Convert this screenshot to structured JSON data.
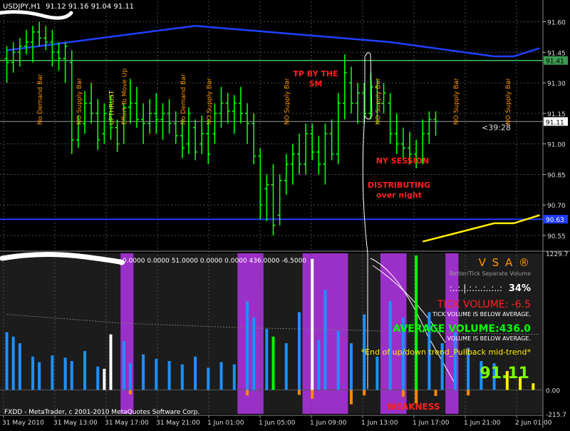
{
  "header": {
    "symbol_label": "USDJPY,H1",
    "ohlc_label": "91.12 91.16 91.04 91.11"
  },
  "price_panel": {
    "ylim": [
      90.48,
      91.7
    ],
    "tick_labels": [
      "91.60",
      "91.45",
      "91.30",
      "91.15",
      "91.00",
      "90.85",
      "90.70",
      "90.55"
    ],
    "tick_values": [
      91.6,
      91.45,
      91.3,
      91.15,
      91.0,
      90.85,
      90.7,
      90.55
    ],
    "current_price": "91.11",
    "green_level": "91.41",
    "blue_level": "90.63",
    "countdown": "<39:28",
    "bar_color": "#00ff00",
    "bars": [
      {
        "o": 91.42,
        "h": 91.48,
        "l": 91.3,
        "c": 91.4
      },
      {
        "o": 91.4,
        "h": 91.5,
        "l": 91.35,
        "c": 91.45
      },
      {
        "o": 91.45,
        "h": 91.52,
        "l": 91.38,
        "c": 91.48
      },
      {
        "o": 91.48,
        "h": 91.56,
        "l": 91.44,
        "c": 91.5
      },
      {
        "o": 91.5,
        "h": 91.58,
        "l": 91.4,
        "c": 91.55
      },
      {
        "o": 91.55,
        "h": 91.6,
        "l": 91.48,
        "c": 91.52
      },
      {
        "o": 91.52,
        "h": 91.58,
        "l": 91.46,
        "c": 91.5
      },
      {
        "o": 91.5,
        "h": 91.56,
        "l": 91.38,
        "c": 91.45
      },
      {
        "o": 91.45,
        "h": 91.5,
        "l": 91.36,
        "c": 91.42
      },
      {
        "o": 91.42,
        "h": 91.5,
        "l": 91.3,
        "c": 91.48
      },
      {
        "o": 91.4,
        "h": 91.46,
        "l": 90.95,
        "c": 91.02
      },
      {
        "o": 91.02,
        "h": 91.14,
        "l": 90.98,
        "c": 91.1
      },
      {
        "o": 91.1,
        "h": 91.26,
        "l": 91.05,
        "c": 91.2
      },
      {
        "o": 91.2,
        "h": 91.3,
        "l": 91.1,
        "c": 91.15
      },
      {
        "o": 91.15,
        "h": 91.22,
        "l": 90.97,
        "c": 91.02
      },
      {
        "o": 91.05,
        "h": 91.2,
        "l": 91.0,
        "c": 91.15
      },
      {
        "o": 91.12,
        "h": 91.24,
        "l": 91.02,
        "c": 91.08
      },
      {
        "o": 91.08,
        "h": 91.12,
        "l": 90.96,
        "c": 91.0
      },
      {
        "o": 91.1,
        "h": 91.2,
        "l": 91.0,
        "c": 91.18
      },
      {
        "o": 91.18,
        "h": 91.32,
        "l": 91.1,
        "c": 91.2
      },
      {
        "o": 91.2,
        "h": 91.28,
        "l": 91.08,
        "c": 91.12
      },
      {
        "o": 91.12,
        "h": 91.2,
        "l": 91.0,
        "c": 91.1
      },
      {
        "o": 91.1,
        "h": 91.22,
        "l": 91.05,
        "c": 91.15
      },
      {
        "o": 91.15,
        "h": 91.25,
        "l": 91.05,
        "c": 91.12
      },
      {
        "o": 91.12,
        "h": 91.2,
        "l": 91.02,
        "c": 91.15
      },
      {
        "o": 91.15,
        "h": 91.22,
        "l": 91.05,
        "c": 91.1
      },
      {
        "o": 91.1,
        "h": 91.16,
        "l": 91.0,
        "c": 91.04
      },
      {
        "o": 91.04,
        "h": 91.12,
        "l": 90.93,
        "c": 90.98
      },
      {
        "o": 91.0,
        "h": 91.18,
        "l": 90.95,
        "c": 91.15
      },
      {
        "o": 91.08,
        "h": 91.12,
        "l": 90.92,
        "c": 90.96
      },
      {
        "o": 91.0,
        "h": 91.14,
        "l": 90.95,
        "c": 91.05
      },
      {
        "o": 91.05,
        "h": 91.12,
        "l": 90.9,
        "c": 90.95
      },
      {
        "o": 91.05,
        "h": 91.2,
        "l": 91.0,
        "c": 91.15
      },
      {
        "o": 91.15,
        "h": 91.28,
        "l": 91.08,
        "c": 91.2
      },
      {
        "o": 91.2,
        "h": 91.25,
        "l": 91.1,
        "c": 91.16
      },
      {
        "o": 91.16,
        "h": 91.24,
        "l": 91.05,
        "c": 91.2
      },
      {
        "o": 91.2,
        "h": 91.28,
        "l": 91.1,
        "c": 91.15
      },
      {
        "o": 91.15,
        "h": 91.2,
        "l": 91.0,
        "c": 91.1
      },
      {
        "o": 91.1,
        "h": 91.15,
        "l": 90.9,
        "c": 90.94
      },
      {
        "o": 90.94,
        "h": 90.98,
        "l": 90.63,
        "c": 90.7
      },
      {
        "o": 90.78,
        "h": 90.85,
        "l": 90.62,
        "c": 90.8
      },
      {
        "o": 90.8,
        "h": 90.9,
        "l": 90.55,
        "c": 90.6
      },
      {
        "o": 90.65,
        "h": 90.85,
        "l": 90.6,
        "c": 90.82
      },
      {
        "o": 90.82,
        "h": 90.95,
        "l": 90.75,
        "c": 90.9
      },
      {
        "o": 90.9,
        "h": 91.0,
        "l": 90.8,
        "c": 90.95
      },
      {
        "o": 90.95,
        "h": 91.05,
        "l": 90.85,
        "c": 90.9
      },
      {
        "o": 90.9,
        "h": 91.1,
        "l": 90.85,
        "c": 91.05
      },
      {
        "o": 91.05,
        "h": 91.1,
        "l": 90.92,
        "c": 90.96
      },
      {
        "o": 90.96,
        "h": 91.04,
        "l": 90.85,
        "c": 90.9
      },
      {
        "o": 90.9,
        "h": 91.1,
        "l": 90.8,
        "c": 91.05
      },
      {
        "o": 91.05,
        "h": 91.12,
        "l": 90.92,
        "c": 90.95
      },
      {
        "o": 90.95,
        "h": 91.25,
        "l": 90.9,
        "c": 91.2
      },
      {
        "o": 91.2,
        "h": 91.44,
        "l": 91.12,
        "c": 91.35
      },
      {
        "o": 91.3,
        "h": 91.38,
        "l": 91.15,
        "c": 91.2
      },
      {
        "o": 91.2,
        "h": 91.3,
        "l": 91.1,
        "c": 91.25
      },
      {
        "o": 91.25,
        "h": 91.3,
        "l": 91.1,
        "c": 91.15
      },
      {
        "o": 91.15,
        "h": 91.35,
        "l": 91.12,
        "c": 91.28
      },
      {
        "o": 91.28,
        "h": 91.32,
        "l": 91.1,
        "c": 91.2
      },
      {
        "o": 91.2,
        "h": 91.3,
        "l": 91.15,
        "c": 91.25
      },
      {
        "o": 91.2,
        "h": 91.25,
        "l": 91.0,
        "c": 91.05
      },
      {
        "o": 91.05,
        "h": 91.15,
        "l": 90.95,
        "c": 91.0
      },
      {
        "o": 91.0,
        "h": 91.08,
        "l": 90.93,
        "c": 90.98
      },
      {
        "o": 90.98,
        "h": 91.06,
        "l": 90.9,
        "c": 90.95
      },
      {
        "o": 90.95,
        "h": 91.02,
        "l": 90.88,
        "c": 90.92
      },
      {
        "o": 90.92,
        "h": 91.12,
        "l": 90.9,
        "c": 91.05
      },
      {
        "o": 91.05,
        "h": 91.16,
        "l": 91.0,
        "c": 91.12
      },
      {
        "o": 91.12,
        "h": 91.16,
        "l": 91.04,
        "c": 91.11
      }
    ],
    "blue_trend": [
      [
        0,
        91.46
      ],
      [
        29,
        91.58
      ],
      [
        59,
        91.5
      ],
      [
        75,
        91.43
      ],
      [
        78,
        91.43
      ],
      [
        82,
        91.47
      ]
    ],
    "yellow_trend": [
      [
        64,
        90.52
      ],
      [
        75,
        90.61
      ],
      [
        78,
        90.61
      ],
      [
        82,
        90.65
      ]
    ],
    "vertical_labels": [
      {
        "bar": 5,
        "text": "No Demand Bar",
        "color": "#ff9900"
      },
      {
        "bar": 11,
        "text": "NO Supply Bar",
        "color": "#ff9900"
      },
      {
        "bar": 16,
        "text": "UPTHRUST",
        "color": "#ffee00"
      },
      {
        "bar": 18,
        "text": "Effort To Move Up",
        "color": "#ff9900"
      },
      {
        "bar": 27,
        "text": "No Demand Bar",
        "color": "#ff9900"
      },
      {
        "bar": 31,
        "text": "NO Supply Bar",
        "color": "#ff9900"
      },
      {
        "bar": 43,
        "text": "NO Supply Bar",
        "color": "#ff9900"
      },
      {
        "bar": 57,
        "text": "NO Supply Bar",
        "color": "#ff9900"
      },
      {
        "bar": 69,
        "text": "NO Supply Bar",
        "color": "#ff9900"
      },
      {
        "bar": 77,
        "text": "NO Supply Bar",
        "color": "#ff9900"
      }
    ],
    "annotations": [
      {
        "line1": "TP BY THE",
        "line2": "SM",
        "color": "#ff2020"
      },
      {
        "line1": "NY SESSION",
        "line2": "",
        "color": "#ff2020"
      },
      {
        "line1": "DISTRIBUTING",
        "line2": "over night",
        "color": "#ff2020"
      }
    ]
  },
  "volume_panel": {
    "header_values": "0.0000 0.0000 51.0000 0.0000 0.0000 436.0000 -6.5000",
    "ylim": [
      -215.7,
      1229.7
    ],
    "tick_labels": [
      "1229.7",
      "0.00",
      "-215.7"
    ],
    "tick_values": [
      1229.7,
      0.0,
      -215.7
    ],
    "purple_zones": [
      [
        18,
        19
      ],
      [
        36,
        39
      ],
      [
        46,
        52
      ],
      [
        58,
        61
      ],
      [
        68,
        69
      ]
    ],
    "bars": [
      {
        "v": 520,
        "c": "#1e90ff"
      },
      {
        "v": 480,
        "c": "#1e90ff"
      },
      {
        "v": 420,
        "c": "#1e90ff"
      },
      {
        "v": 0,
        "c": "#1e90ff"
      },
      {
        "v": 300,
        "c": "#1e90ff"
      },
      {
        "v": 250,
        "c": "#1e90ff"
      },
      {
        "v": 0,
        "c": "#1e90ff"
      },
      {
        "v": 310,
        "c": "#1e90ff"
      },
      {
        "v": 0,
        "c": "#1e90ff"
      },
      {
        "v": 290,
        "c": "#1e90ff"
      },
      {
        "v": 260,
        "c": "#1e90ff"
      },
      {
        "v": 0,
        "c": "#1e90ff"
      },
      {
        "v": 350,
        "c": "#1e90ff"
      },
      {
        "v": 0,
        "c": "#1e90ff"
      },
      {
        "v": 210,
        "c": "#1e90ff"
      },
      {
        "v": 190,
        "c": "#ffffff"
      },
      {
        "v": 500,
        "c": "#ffffff"
      },
      {
        "v": 0,
        "c": "#1e90ff"
      },
      {
        "v": 440,
        "c": "#1e90ff"
      },
      {
        "v": 240,
        "c": "#1e90ff"
      },
      {
        "v": 0,
        "c": "#1e90ff"
      },
      {
        "v": 320,
        "c": "#1e90ff"
      },
      {
        "v": 0,
        "c": "#1e90ff"
      },
      {
        "v": 280,
        "c": "#1e90ff"
      },
      {
        "v": 0,
        "c": "#1e90ff"
      },
      {
        "v": 260,
        "c": "#1e90ff"
      },
      {
        "v": 0,
        "c": "#1e90ff"
      },
      {
        "v": 230,
        "c": "#1e90ff"
      },
      {
        "v": 0,
        "c": "#1e90ff"
      },
      {
        "v": 300,
        "c": "#1e90ff"
      },
      {
        "v": 0,
        "c": "#1e90ff"
      },
      {
        "v": 200,
        "c": "#1e90ff"
      },
      {
        "v": 0,
        "c": "#1e90ff"
      },
      {
        "v": 250,
        "c": "#1e90ff"
      },
      {
        "v": 0,
        "c": "#1e90ff"
      },
      {
        "v": 230,
        "c": "#1e90ff"
      },
      {
        "v": 0,
        "c": "#1e90ff"
      },
      {
        "v": 800,
        "c": "#1e90ff"
      },
      {
        "v": 650,
        "c": "#1e90ff"
      },
      {
        "v": 0,
        "c": "#1e90ff"
      },
      {
        "v": 550,
        "c": "#1e90ff"
      },
      {
        "v": 480,
        "c": "#00ff00"
      },
      {
        "v": 0,
        "c": "#1e90ff"
      },
      {
        "v": 420,
        "c": "#1e90ff"
      },
      {
        "v": 0,
        "c": "#1e90ff"
      },
      {
        "v": 700,
        "c": "#1e90ff"
      },
      {
        "v": 0,
        "c": "#ffffff"
      },
      {
        "v": 1180,
        "c": "#ffffff"
      },
      {
        "v": 450,
        "c": "#1e90ff"
      },
      {
        "v": 900,
        "c": "#1e90ff"
      },
      {
        "v": 0,
        "c": "#1e90ff"
      },
      {
        "v": 530,
        "c": "#1e90ff"
      },
      {
        "v": 0,
        "c": "#1e90ff"
      },
      {
        "v": 420,
        "c": "#1e90ff"
      },
      {
        "v": 0,
        "c": "#1e90ff"
      },
      {
        "v": 680,
        "c": "#1e90ff"
      },
      {
        "v": 0,
        "c": "#1e90ff"
      },
      {
        "v": 300,
        "c": "#1e90ff"
      },
      {
        "v": 0,
        "c": "#1e90ff"
      },
      {
        "v": 800,
        "c": "#1e90ff"
      },
      {
        "v": 0,
        "c": "#1e90ff"
      },
      {
        "v": 650,
        "c": "#1e90ff"
      },
      {
        "v": 0,
        "c": "#00ff00"
      },
      {
        "v": 1210,
        "c": "#00ff00"
      },
      {
        "v": 0,
        "c": "#1e90ff"
      },
      {
        "v": 700,
        "c": "#1e90ff"
      },
      {
        "v": 0,
        "c": "#1e90ff"
      },
      {
        "v": 420,
        "c": "#1e90ff"
      },
      {
        "v": 0,
        "c": "#1e90ff"
      },
      {
        "v": 520,
        "c": "#1e90ff"
      },
      {
        "v": 0,
        "c": "#1e90ff"
      },
      {
        "v": 380,
        "c": "#1e90ff"
      },
      {
        "v": 0,
        "c": "#1e90ff"
      },
      {
        "v": 260,
        "c": "#1e90ff"
      },
      {
        "v": 0,
        "c": "#1e90ff"
      },
      {
        "v": 240,
        "c": "#1e90ff"
      },
      {
        "v": 0,
        "c": "#ffee00"
      },
      {
        "v": 170,
        "c": "#ffee00"
      },
      {
        "v": 0,
        "c": "#ffee00"
      },
      {
        "v": 120,
        "c": "#ffee00"
      },
      {
        "v": 0,
        "c": "#ffee00"
      },
      {
        "v": 60,
        "c": "#ffee00"
      }
    ],
    "neg_bars": [
      {
        "i": 19,
        "v": -40,
        "c": "#ff8800"
      },
      {
        "i": 37,
        "v": -50,
        "c": "#ff8800"
      },
      {
        "i": 45,
        "v": -45,
        "c": "#ff8800"
      },
      {
        "i": 47,
        "v": -80,
        "c": "#ff8800"
      },
      {
        "i": 53,
        "v": -130,
        "c": "#ff8800"
      },
      {
        "i": 55,
        "v": -50,
        "c": "#ff8800"
      },
      {
        "i": 61,
        "v": -60,
        "c": "#ff8800"
      },
      {
        "i": 63,
        "v": -120,
        "c": "#ff8800"
      },
      {
        "i": 66,
        "v": -55,
        "c": "#ff8800"
      },
      {
        "i": 71,
        "v": -50,
        "c": "#ff8800"
      }
    ],
    "avg_line": [
      [
        0,
        680
      ],
      [
        18,
        600
      ],
      [
        36,
        560
      ],
      [
        52,
        540
      ],
      [
        70,
        510
      ],
      [
        82,
        500
      ]
    ]
  },
  "vsa_panel": {
    "title": "V S A ®",
    "subtitle": "Better/Tick Separate Volume",
    "progress_text": ":..:.|.:.:..:..:..:",
    "percent": "34%",
    "tick_volume_label": "TICK VOLUME: -6.5",
    "tick_volume_note": "TICK VOLUME IS BELOW AVERAGE.",
    "average_volume_label": "AVERAGE VOLUME:436.0",
    "average_volume_note": "VOLUME IS BELOW AVERAGE.",
    "trend_note": "*End of up/down trend_Pullback mid-trend*",
    "price": "91.11",
    "weakness": "WEAKNESS",
    "colors": {
      "tick": "#ff2020",
      "average": "#00ff00",
      "price": "#7cfc00",
      "trend": "#ffee00"
    }
  },
  "footer": {
    "copyright": "FXDD - MetaTrader, c 2001-2010 MetaQuotes Software Corp."
  },
  "x_axis": {
    "labels": [
      "31 May 2010",
      "31 May 13:00",
      "31 May 17:00",
      "31 May 21:00",
      "1 Jun 01:00",
      "1 Jun 05:00",
      "1 Jun 09:00",
      "1 Jun 13:00",
      "1 Jun 17:00",
      "1 Jun 21:00",
      "2 Jun 01:00"
    ]
  },
  "chart_data": {
    "type": "line",
    "title": "USDJPY,H1",
    "xlabel": "",
    "ylabel": "",
    "x_tick_labels": [
      "31 May 2010",
      "31 May 13:00",
      "31 May 17:00",
      "31 May 21:00",
      "1 Jun 01:00",
      "1 Jun 05:00",
      "1 Jun 09:00",
      "1 Jun 13:00",
      "1 Jun 17:00",
      "1 Jun 21:00",
      "2 Jun 01:00"
    ],
    "ylim": [
      90.48,
      91.7
    ],
    "note": "Price OHLC bars listed in price_panel.bars; volume histogram in volume_panel.bars"
  }
}
